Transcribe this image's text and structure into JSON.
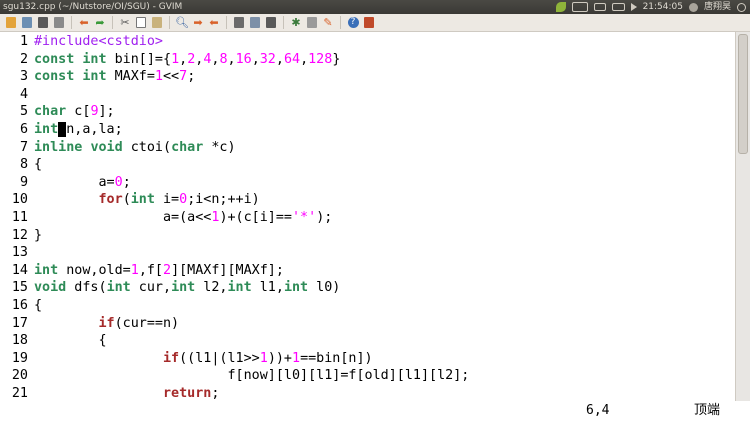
{
  "window": {
    "title": "sgu132.cpp (~/Nutstore/OI/SGU) - GVIM"
  },
  "tray": {
    "time": "21:54:05",
    "user": "唐翔昊"
  },
  "toolbar": {
    "icons": [
      "open-icon",
      "save-icon",
      "save-all-icon",
      "print-icon",
      "undo-icon",
      "redo-icon",
      "cut-icon",
      "copy-icon",
      "paste-icon",
      "find-replace-icon",
      "find-next-icon",
      "find-prev-icon",
      "load-session-icon",
      "save-session-icon",
      "run-script-icon",
      "make-icon",
      "run-ctags-icon",
      "tag-jump-icon",
      "help-icon",
      "help-search-icon"
    ]
  },
  "editor": {
    "colors": {
      "preproc": "#a020f0",
      "type": "#2e8b57",
      "statement": "#a52a2a",
      "constant": "#ff00ff"
    },
    "lines": [
      {
        "n": "1",
        "tokens": [
          [
            "pp",
            "#include<cstdio>"
          ]
        ]
      },
      {
        "n": "2",
        "tokens": [
          [
            "ty",
            "const"
          ],
          [
            "tx",
            " "
          ],
          [
            "ty",
            "int"
          ],
          [
            "tx",
            " bin[]={"
          ],
          [
            "num",
            "1"
          ],
          [
            "tx",
            ","
          ],
          [
            "num",
            "2"
          ],
          [
            "tx",
            ","
          ],
          [
            "num",
            "4"
          ],
          [
            "tx",
            ","
          ],
          [
            "num",
            "8"
          ],
          [
            "tx",
            ","
          ],
          [
            "num",
            "16"
          ],
          [
            "tx",
            ","
          ],
          [
            "num",
            "32"
          ],
          [
            "tx",
            ","
          ],
          [
            "num",
            "64"
          ],
          [
            "tx",
            ","
          ],
          [
            "num",
            "128"
          ],
          [
            "tx",
            "}"
          ]
        ]
      },
      {
        "n": "3",
        "tokens": [
          [
            "ty",
            "const"
          ],
          [
            "tx",
            " "
          ],
          [
            "ty",
            "int"
          ],
          [
            "tx",
            " MAXf="
          ],
          [
            "num",
            "1"
          ],
          [
            "tx",
            "<<"
          ],
          [
            "num",
            "7"
          ],
          [
            "tx",
            ";"
          ]
        ]
      },
      {
        "n": "4",
        "tokens": []
      },
      {
        "n": "5",
        "tokens": [
          [
            "ty",
            "char"
          ],
          [
            "tx",
            " c["
          ],
          [
            "num",
            "9"
          ],
          [
            "tx",
            "];"
          ]
        ]
      },
      {
        "n": "6",
        "tokens": [
          [
            "ty",
            "int"
          ],
          [
            "cursor",
            " "
          ],
          [
            "tx",
            "n,a,la;"
          ]
        ]
      },
      {
        "n": "7",
        "tokens": [
          [
            "ty",
            "inline"
          ],
          [
            "tx",
            " "
          ],
          [
            "ty",
            "void"
          ],
          [
            "tx",
            " ctoi("
          ],
          [
            "ty",
            "char"
          ],
          [
            "tx",
            " *c)"
          ]
        ]
      },
      {
        "n": "8",
        "tokens": [
          [
            "tx",
            "{"
          ]
        ]
      },
      {
        "n": "9",
        "tokens": [
          [
            "tx",
            "        a="
          ],
          [
            "num",
            "0"
          ],
          [
            "tx",
            ";"
          ]
        ]
      },
      {
        "n": "10",
        "tokens": [
          [
            "tx",
            "        "
          ],
          [
            "st",
            "for"
          ],
          [
            "tx",
            "("
          ],
          [
            "ty",
            "int"
          ],
          [
            "tx",
            " i="
          ],
          [
            "num",
            "0"
          ],
          [
            "tx",
            ";i<n;++i)"
          ]
        ]
      },
      {
        "n": "11",
        "tokens": [
          [
            "tx",
            "                a=(a<<"
          ],
          [
            "num",
            "1"
          ],
          [
            "tx",
            ")+(c[i]=="
          ],
          [
            "str",
            "'*'"
          ],
          [
            "tx",
            ");"
          ]
        ]
      },
      {
        "n": "12",
        "tokens": [
          [
            "tx",
            "}"
          ]
        ]
      },
      {
        "n": "13",
        "tokens": []
      },
      {
        "n": "14",
        "tokens": [
          [
            "ty",
            "int"
          ],
          [
            "tx",
            " now,old="
          ],
          [
            "num",
            "1"
          ],
          [
            "tx",
            ",f["
          ],
          [
            "num",
            "2"
          ],
          [
            "tx",
            "][MAXf][MAXf];"
          ]
        ]
      },
      {
        "n": "15",
        "tokens": [
          [
            "ty",
            "void"
          ],
          [
            "tx",
            " dfs("
          ],
          [
            "ty",
            "int"
          ],
          [
            "tx",
            " cur,"
          ],
          [
            "ty",
            "int"
          ],
          [
            "tx",
            " l2,"
          ],
          [
            "ty",
            "int"
          ],
          [
            "tx",
            " l1,"
          ],
          [
            "ty",
            "int"
          ],
          [
            "tx",
            " l0)"
          ]
        ]
      },
      {
        "n": "16",
        "tokens": [
          [
            "tx",
            "{"
          ]
        ]
      },
      {
        "n": "17",
        "tokens": [
          [
            "tx",
            "        "
          ],
          [
            "st",
            "if"
          ],
          [
            "tx",
            "(cur==n)"
          ]
        ]
      },
      {
        "n": "18",
        "tokens": [
          [
            "tx",
            "        {"
          ]
        ]
      },
      {
        "n": "19",
        "tokens": [
          [
            "tx",
            "                "
          ],
          [
            "st",
            "if"
          ],
          [
            "tx",
            "((l1|(l1>>"
          ],
          [
            "num",
            "1"
          ],
          [
            "tx",
            "))+"
          ],
          [
            "num",
            "1"
          ],
          [
            "tx",
            "==bin[n])"
          ]
        ]
      },
      {
        "n": "20",
        "tokens": [
          [
            "tx",
            "                        f[now][l0][l1]=f[old][l1][l2];"
          ]
        ]
      },
      {
        "n": "21",
        "tokens": [
          [
            "tx",
            "                "
          ],
          [
            "st",
            "return"
          ],
          [
            "tx",
            ";"
          ]
        ]
      }
    ]
  },
  "status": {
    "cursor_pos": "6,4",
    "scroll_pos": "顶端"
  }
}
